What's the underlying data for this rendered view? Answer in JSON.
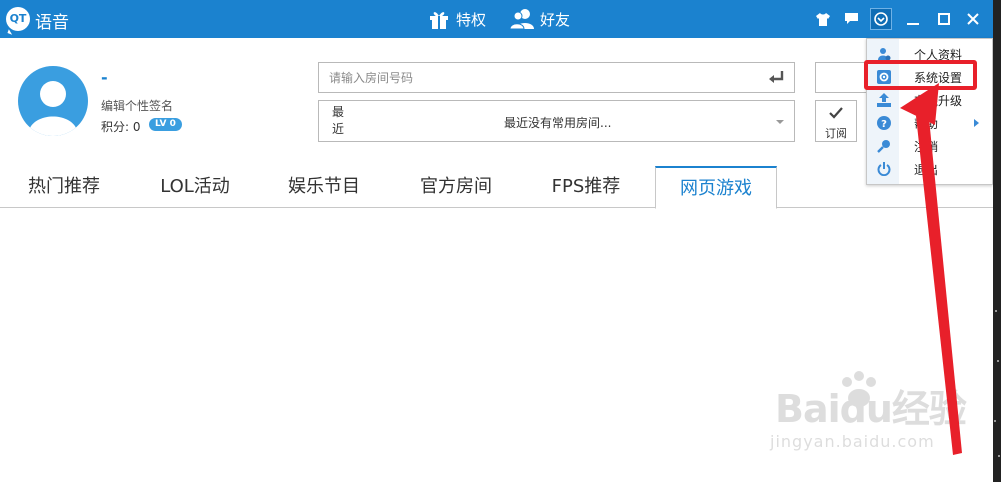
{
  "titlebar": {
    "logo_text": "QT",
    "app_title": "语音",
    "nav": [
      {
        "label": "特权",
        "icon": "gift-icon"
      },
      {
        "label": "好友",
        "icon": "friends-icon"
      }
    ],
    "buttons": [
      "shirt-icon",
      "message-icon",
      "menu-toggle-icon",
      "minimize-icon",
      "maximize-icon",
      "close-icon"
    ],
    "color": "#1b82cf"
  },
  "profile": {
    "username": "-",
    "signature": "编辑个性签名",
    "points_label": "积分: 0",
    "level": "LV 0"
  },
  "room_search": {
    "placeholder": "请输入房间号码",
    "recent_label": "最近",
    "recent_text": "最近没有常用房间..."
  },
  "subscribe": {
    "label": "订阅"
  },
  "tabs": [
    {
      "label": "热门推荐",
      "active": false
    },
    {
      "label": "LOL活动",
      "active": false
    },
    {
      "label": "娱乐节目",
      "active": false
    },
    {
      "label": "官方房间",
      "active": false
    },
    {
      "label": "FPS推荐",
      "active": false
    },
    {
      "label": "网页游戏",
      "active": true
    }
  ],
  "menu": {
    "items": [
      {
        "label": "个人资料",
        "icon": "profile-icon",
        "submenu": false
      },
      {
        "label": "系统设置",
        "icon": "settings-icon",
        "submenu": false,
        "highlighted": true
      },
      {
        "label": "在线升级",
        "icon": "upgrade-icon",
        "submenu": false
      },
      {
        "label": "帮助",
        "icon": "help-icon",
        "submenu": true
      },
      {
        "label": "注销",
        "icon": "key-icon",
        "submenu": false
      },
      {
        "label": "退出",
        "icon": "power-icon",
        "submenu": false
      }
    ]
  },
  "watermark": {
    "brand": "Baidu经验",
    "url": "jingyan.baidu.com"
  },
  "annotation_color": "#e8202a"
}
